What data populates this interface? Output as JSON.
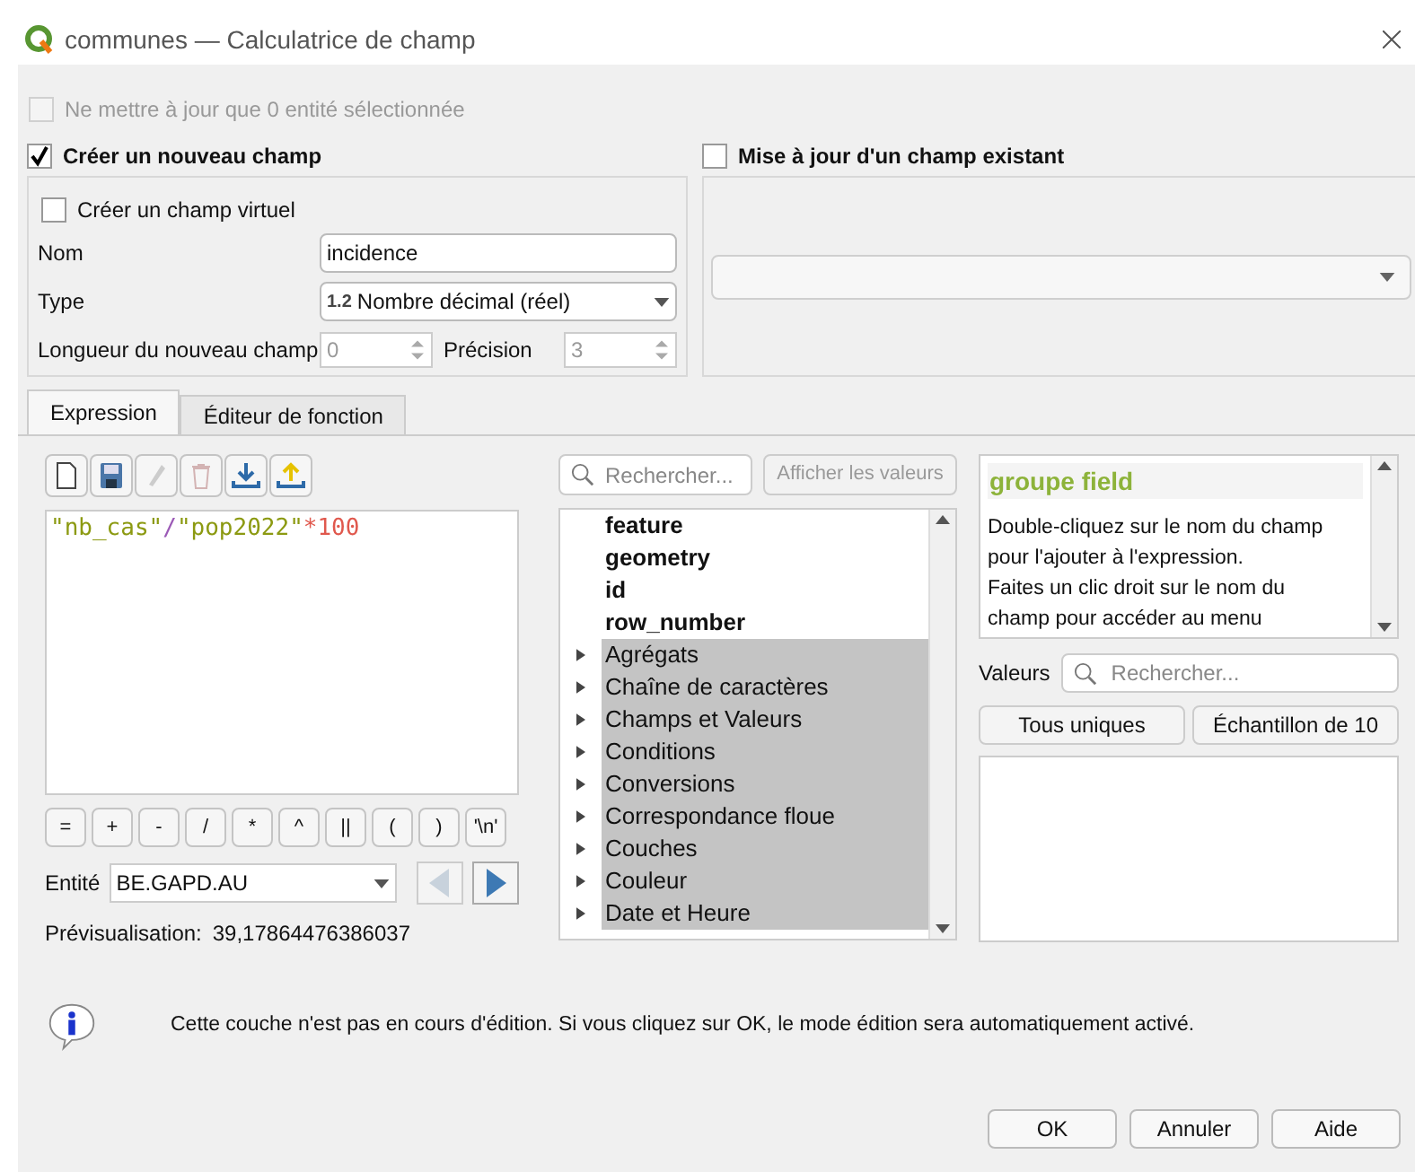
{
  "window": {
    "title": "communes — Calculatrice de champ"
  },
  "only_selected": {
    "label": "Ne mettre à jour que 0 entité sélectionnée",
    "checked": false,
    "disabled": true
  },
  "new_field": {
    "label": "Créer un nouveau champ",
    "checked": true,
    "virtual": {
      "label": "Créer un champ virtuel",
      "checked": false
    },
    "name": {
      "label": "Nom",
      "value": "incidence"
    },
    "type": {
      "label": "Type",
      "badge": "1.2",
      "value": "Nombre décimal (réel)"
    },
    "length": {
      "label": "Longueur du nouveau champ",
      "value": "0"
    },
    "precision": {
      "label": "Précision",
      "value": "3"
    }
  },
  "update_field": {
    "label": "Mise à jour d'un champ existant",
    "checked": false
  },
  "tabs": [
    {
      "label": "Expression",
      "selected": true
    },
    {
      "label": "Éditeur de fonction",
      "selected": false
    }
  ],
  "expression": {
    "tokens": [
      {
        "kind": "string",
        "text": "\"nb_cas\""
      },
      {
        "kind": "operator",
        "text": "/"
      },
      {
        "kind": "string",
        "text": "\"pop2022\""
      },
      {
        "kind": "number",
        "text": "*100"
      }
    ]
  },
  "operators": [
    "=",
    "+",
    "-",
    "/",
    "*",
    "^",
    "||",
    "(",
    ")",
    "'\\n'"
  ],
  "entity": {
    "label": "Entité",
    "value": "BE.GAPD.AU"
  },
  "preview": {
    "label": "Prévisualisation:",
    "value": "39,17864476386037"
  },
  "function_search": {
    "placeholder": "Rechercher..."
  },
  "show_values": {
    "label": "Afficher les valeurs"
  },
  "functions": [
    {
      "kind": "field",
      "label": "feature"
    },
    {
      "kind": "field",
      "label": "geometry"
    },
    {
      "kind": "field",
      "label": "id"
    },
    {
      "kind": "field",
      "label": "row_number"
    },
    {
      "kind": "group",
      "label": "Agrégats"
    },
    {
      "kind": "group",
      "label": "Chaîne de caractères"
    },
    {
      "kind": "group",
      "label": "Champs et Valeurs"
    },
    {
      "kind": "group",
      "label": "Conditions"
    },
    {
      "kind": "group",
      "label": "Conversions"
    },
    {
      "kind": "group",
      "label": "Correspondance floue"
    },
    {
      "kind": "group",
      "label": "Couches"
    },
    {
      "kind": "group",
      "label": "Couleur"
    },
    {
      "kind": "group",
      "label": "Date et Heure"
    }
  ],
  "help": {
    "title": "groupe field",
    "text": "Double-cliquez sur le nom du champ pour l'ajouter à l'expression.\nFaites un clic droit sur le nom du champ pour accéder au menu"
  },
  "values": {
    "label": "Valeurs",
    "placeholder": "Rechercher...",
    "buttons": [
      "Tous uniques",
      "Échantillon de 10"
    ]
  },
  "info": {
    "text": "Cette couche n'est pas en cours d'édition. Si vous cliquez sur OK, le mode édition sera automatiquement activé."
  },
  "buttons": [
    "OK",
    "Annuler",
    "Aide"
  ]
}
